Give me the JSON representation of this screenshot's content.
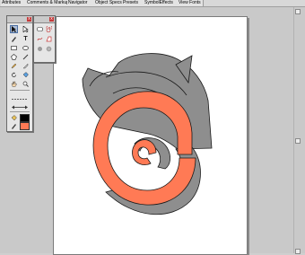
{
  "tabs": [
    {
      "label": "Attributes"
    },
    {
      "label": "Comments & Markup"
    },
    {
      "label": "Navigator"
    },
    {
      "label": "Object Specs"
    },
    {
      "label": "Presets"
    },
    {
      "label": "SymbolEffects"
    },
    {
      "label": "View Fonts"
    }
  ],
  "toolbox": {
    "close_label": "x",
    "tool_text_glyph": "T",
    "fill_color": "#000000",
    "stroke_color": "#ff7a55"
  },
  "palette2": {
    "close_label": "x"
  },
  "colors": {
    "shape_gray": "#8e8e8e",
    "spiral_orange": "#ff7a55",
    "outline": "#1a1a1a"
  }
}
